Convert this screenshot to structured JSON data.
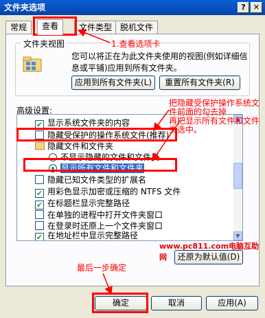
{
  "window": {
    "title": "文件夹选项",
    "help_btn": "?",
    "close_btn": "✕"
  },
  "tabs": [
    {
      "label": "常规"
    },
    {
      "label": "查看"
    },
    {
      "label": "文件类型"
    },
    {
      "label": "脱机文件"
    }
  ],
  "folder_view": {
    "title": "文件夹视图",
    "description": "您可以将正在为此文件夹使用的视图(例如详细信息或平铺)应用到所有文件夹。",
    "apply_all": "应用到所有文件夹(L)",
    "reset_all": "重置所有文件夹(R)"
  },
  "advanced": {
    "label": "高级设置:",
    "items": [
      {
        "type": "checkbox",
        "checked": true,
        "label": "显示系统文件夹的内容"
      },
      {
        "type": "checkbox",
        "checked": false,
        "label": "隐藏受保护的操作系统文件(推荐)"
      },
      {
        "type": "folder",
        "label": "隐藏文件和文件夹"
      },
      {
        "type": "radio",
        "checked": false,
        "label": "不显示隐藏的文件和文件夹"
      },
      {
        "type": "radio",
        "checked": true,
        "label": "显示所有文件和文件夹"
      },
      {
        "type": "checkbox",
        "checked": false,
        "label": "隐藏已知文件类型的扩展名"
      },
      {
        "type": "checkbox",
        "checked": true,
        "label": "用彩色显示加密或压缩的 NTFS 文件"
      },
      {
        "type": "checkbox",
        "checked": true,
        "label": "在标题栏显示完整路径"
      },
      {
        "type": "checkbox",
        "checked": false,
        "label": "在单独的进程中打开文件夹窗口"
      },
      {
        "type": "checkbox",
        "checked": false,
        "label": "在登录时还原上一个文件夹窗口"
      },
      {
        "type": "checkbox",
        "checked": true,
        "label": "在地址栏中显示完整路径"
      }
    ],
    "restore_defaults": "还原为默认值(D)"
  },
  "footer": {
    "ok": "确定",
    "cancel": "取消",
    "apply": "应用(A)"
  },
  "annotations": {
    "step1": "1.查看选项卡",
    "step2_line1": "把隐藏受保护操作系统文",
    "step2_line2": "件前面的勾去掉",
    "step2_line3": "再把显示所有文件和文件",
    "step2_line4": "夹选中。",
    "final": "最后一步确定",
    "watermark": "www.pc811.com电脑互助网"
  },
  "colors": {
    "accent_red": "#ff0000",
    "title_blue": "#0842a8",
    "selection_blue": "#316ac5"
  }
}
